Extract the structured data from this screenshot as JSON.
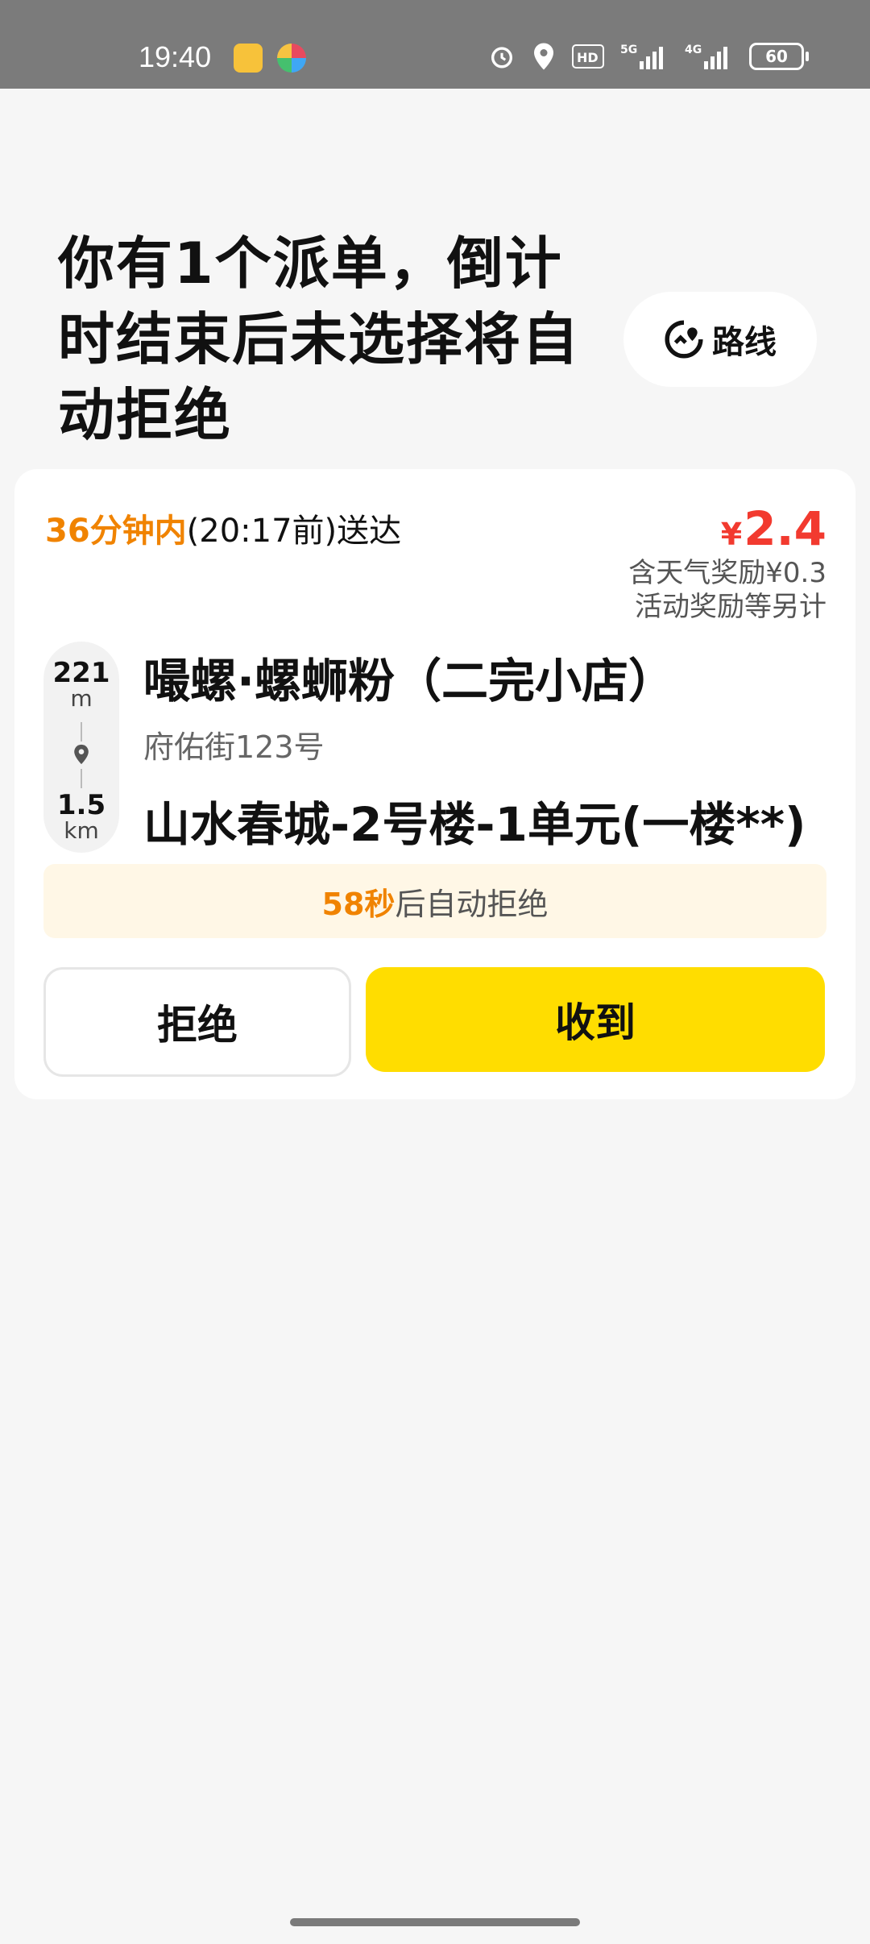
{
  "status_bar": {
    "time": "19:40",
    "battery": "60",
    "icons": [
      "alarm-icon",
      "location-icon",
      "hd-icon",
      "5g-signal-icon",
      "4g-signal-icon",
      "battery-icon"
    ]
  },
  "header": {
    "title": "你有1个派单，倒计时结束后未选择将自动拒绝",
    "route_button_label": "路线"
  },
  "order": {
    "eta_highlight": "36分钟内",
    "eta_rest": "(20:17前)送达",
    "price_currency": "¥",
    "price_value": "2.4",
    "bonus_line1": "含天气奖励¥0.3",
    "bonus_line2": "活动奖励等另计",
    "pickup_distance": "221",
    "pickup_unit": "m",
    "dropoff_distance": "1.5",
    "dropoff_unit": "km",
    "shop_name": "嘬螺·螺蛳粉（二完小店）",
    "shop_address": "府佑街123号",
    "destination": "山水春城-2号楼-1单元(一楼**)",
    "countdown_seconds": "58秒",
    "countdown_text": "后自动拒绝",
    "reject_label": "拒绝",
    "accept_label": "收到"
  },
  "colors": {
    "accent_orange": "#f08300",
    "price_red": "#f23a2f",
    "accept_yellow": "#ffdd00"
  }
}
